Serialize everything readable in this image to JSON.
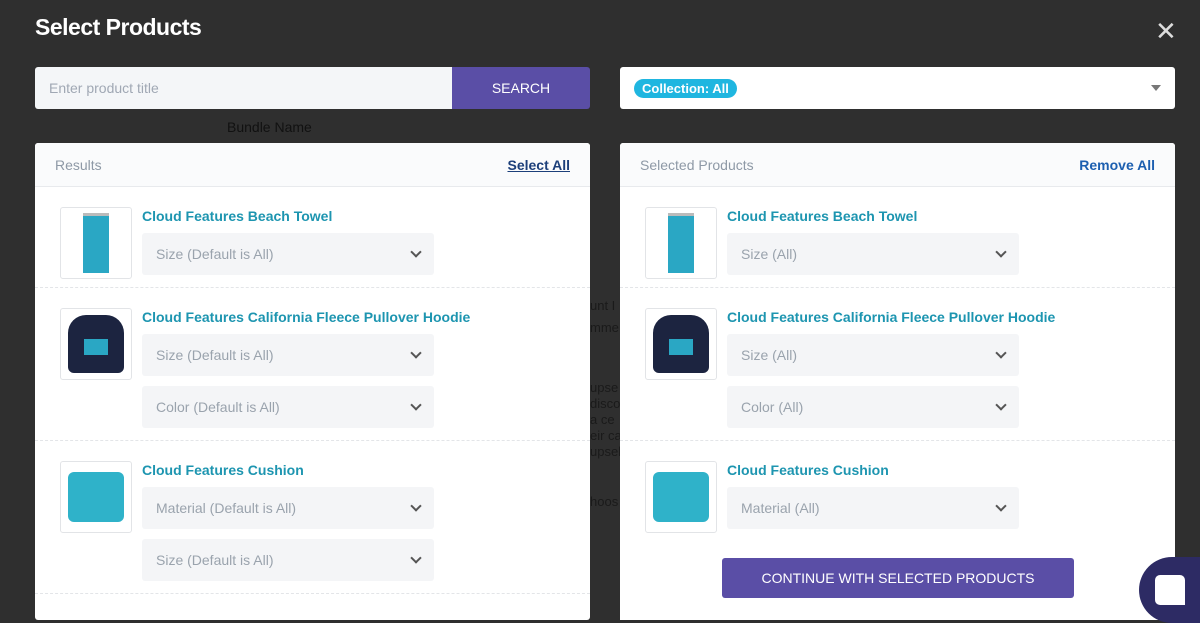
{
  "title": "Select Products",
  "search": {
    "placeholder": "Enter product title",
    "button": "SEARCH"
  },
  "collection": {
    "badge": "Collection: All"
  },
  "bundle_label": "Bundle Name",
  "background_fragments": [
    "unt I",
    "mme",
    "upse",
    "disco",
    "a ce",
    "eir ca",
    "upsel",
    "hoos"
  ],
  "results": {
    "header": "Results",
    "select_all": "Select All",
    "items": [
      {
        "name": "Cloud Features Beach Towel",
        "thumb": "towel",
        "options": [
          "Size (Default is All)"
        ]
      },
      {
        "name": "Cloud Features California Fleece Pullover Hoodie",
        "thumb": "hoodie",
        "options": [
          "Size (Default is All)",
          "Color (Default is All)"
        ]
      },
      {
        "name": "Cloud Features Cushion",
        "thumb": "cushion",
        "options": [
          "Material (Default is All)",
          "Size (Default is All)"
        ]
      }
    ]
  },
  "selected": {
    "header": "Selected Products",
    "remove_all": "Remove All",
    "items": [
      {
        "name": "Cloud Features Beach Towel",
        "thumb": "towel",
        "options": [
          "Size (All)"
        ]
      },
      {
        "name": "Cloud Features California Fleece Pullover Hoodie",
        "thumb": "hoodie",
        "options": [
          "Size (All)",
          "Color (All)"
        ]
      },
      {
        "name": "Cloud Features Cushion",
        "thumb": "cushion",
        "options": [
          "Material (All)"
        ]
      }
    ]
  },
  "continue_button": "CONTINUE WITH SELECTED PRODUCTS",
  "colors": {
    "accent": "#5a4ea6",
    "badge": "#1fb6e0",
    "link": "#1d95b0"
  }
}
